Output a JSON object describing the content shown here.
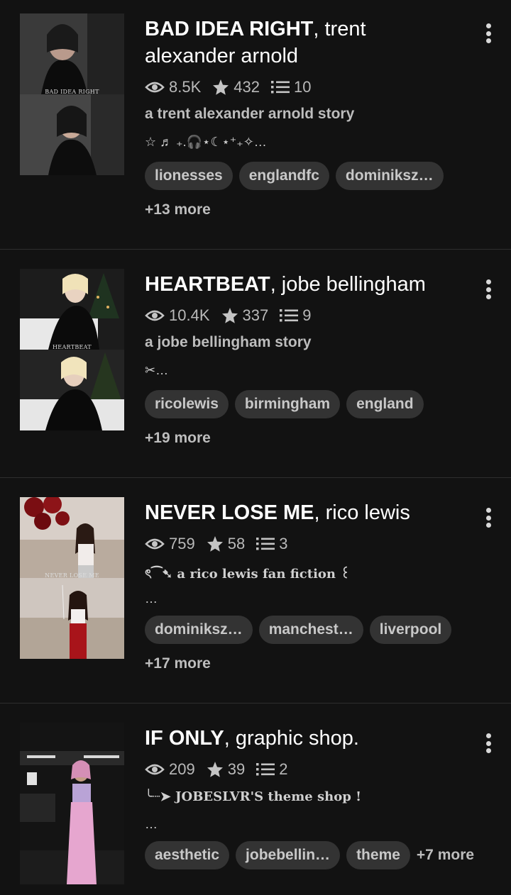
{
  "stories": [
    {
      "title_bold": "BAD IDEA RIGHT",
      "title_rest": ", trent alexander arnold",
      "cover_caption": "BAD IDEA RIGHT",
      "views": "8.5K",
      "votes": "432",
      "parts": "10",
      "description": "a trent alexander arnold story",
      "decoration": "☆ ♬ ₊.🎧⋆☾⋆⁺₊✧…",
      "tags": [
        "lionesses",
        "englandfc",
        "dominiksz…"
      ],
      "more": "+13 more"
    },
    {
      "title_bold": "HEARTBEAT",
      "title_rest": ", jobe bellingham",
      "cover_caption": "HEARTBEAT",
      "views": "10.4K",
      "votes": "337",
      "parts": "9",
      "description": "a jobe bellingham story",
      "decoration": "✂︎…",
      "tags": [
        "ricolewis",
        "birmingham",
        "england"
      ],
      "more": "+19 more"
    },
    {
      "title_bold": "NEVER LOSE ME",
      "title_rest": ", rico lewis",
      "cover_caption": "NEVER LOSE ME",
      "views": "759",
      "votes": "58",
      "parts": "3",
      "description": "ৎ⁀➷ a rico lewis fan fiction ꒰",
      "decoration": "…",
      "tags": [
        "dominiksz…",
        "manchest…",
        "liverpool"
      ],
      "more": "+17 more"
    },
    {
      "title_bold": "IF ONLY",
      "title_rest": ", graphic shop.",
      "cover_caption": "",
      "views": "209",
      "votes": "39",
      "parts": "2",
      "description": "╰┈➤ JOBESLVR'S theme shop !",
      "decoration": "…",
      "tags": [
        "aesthetic",
        "jobebellin…",
        "theme"
      ],
      "more": "+7 more"
    }
  ],
  "colors": {
    "background": "#121212",
    "tag_bg": "#333333",
    "muted_text": "#b9b9b9",
    "divider": "#2e2e2e"
  },
  "icons": [
    "eye-icon",
    "star-icon",
    "list-icon",
    "more-vert-icon"
  ]
}
